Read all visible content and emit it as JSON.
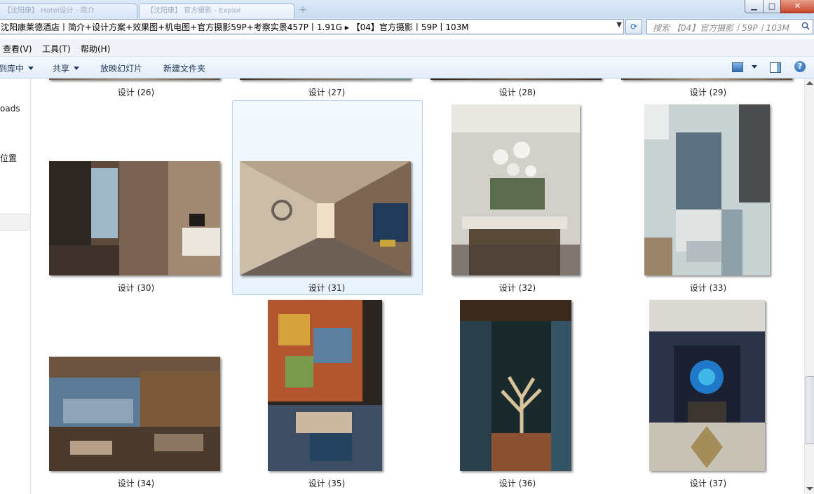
{
  "window": {
    "tabs": [
      "【沈阳康】 Hotel设计 - 简介",
      "【沈阳康】 官方摄影 - Explor"
    ],
    "controls": {
      "minimize": "▁",
      "maximize": "□",
      "close": "✕"
    }
  },
  "address": {
    "path": "沈阳康莱德酒店丨简介+设计方案+效果图+机电图+官方摄影59P+考察实景457P丨1.91G  ▸  【04】官方摄影丨59P丨103M",
    "search_placeholder": "搜索 【04】官方摄影丨59P丨103M"
  },
  "menu": [
    "查看(V)",
    "工具(T)",
    "帮助(H)"
  ],
  "toolbar": {
    "include_library": "到库中",
    "share": "共享",
    "slideshow": "放映幻灯片",
    "new_folder": "新建文件夹",
    "help": "?"
  },
  "nav": {
    "items": [
      "oads",
      "位置"
    ]
  },
  "files": {
    "row0": [
      "设计 (26)",
      "设计 (27)",
      "设计 (28)",
      "设计 (29)"
    ],
    "row1": [
      "设计 (30)",
      "设计 (31)",
      "设计 (32)",
      "设计 (33)"
    ],
    "row2": [
      "设计 (34)",
      "设计 (35)",
      "设计 (36)",
      "设计 (37)"
    ]
  },
  "selected_file": "设计 (31)",
  "colors": {
    "selection_border": "#b9d6f3",
    "accent": "#1e395b",
    "close_button": "#c7442b"
  }
}
